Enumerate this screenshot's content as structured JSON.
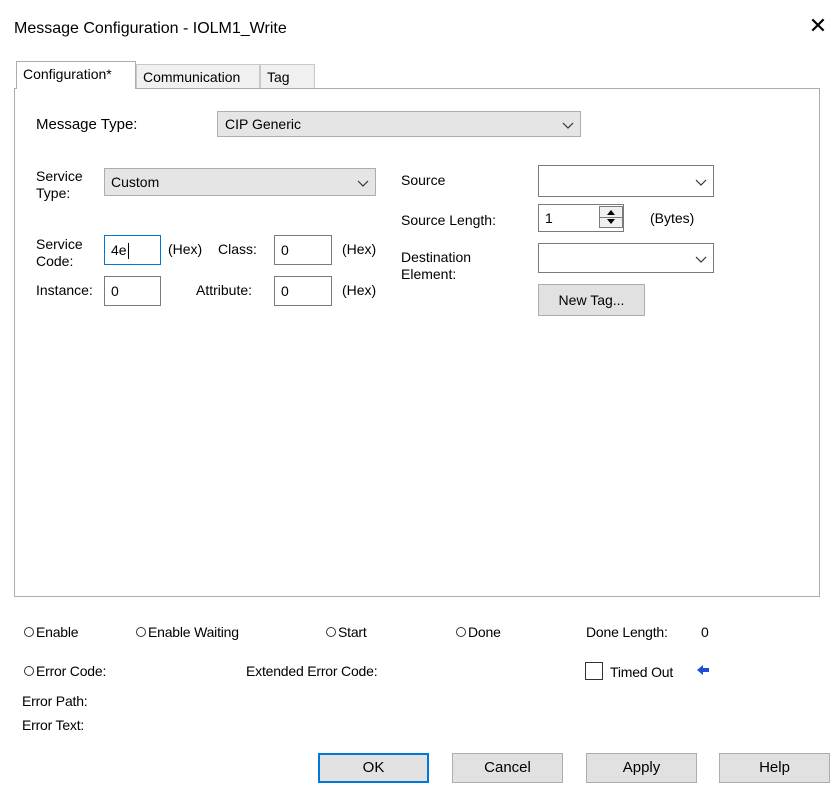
{
  "window": {
    "title": "Message Configuration - IOLM1_Write",
    "close_glyph": "✕"
  },
  "tabs": [
    {
      "label": "Configuration*",
      "active": true
    },
    {
      "label": "Communication",
      "active": false
    },
    {
      "label": "Tag",
      "active": false
    }
  ],
  "config": {
    "message_type_label": "Message Type:",
    "message_type_value": "CIP Generic",
    "service_type_label_1": "Service",
    "service_type_label_2": "Type:",
    "service_type_value": "Custom",
    "service_code_label_1": "Service",
    "service_code_label_2": "Code:",
    "service_code_value": "4e",
    "hex_label": "(Hex)",
    "class_label": "Class:",
    "class_value": "0",
    "instance_label": "Instance:",
    "instance_value": "0",
    "attribute_label": "Attribute:",
    "attribute_value": "0",
    "source_label": "Source",
    "source_value": "",
    "source_length_label": "Source Length:",
    "source_length_value": "1",
    "bytes_label": "(Bytes)",
    "destination_label_1": "Destination",
    "destination_label_2": "Element:",
    "destination_value": "",
    "new_tag_button": "New Tag..."
  },
  "status": {
    "enable": "Enable",
    "enable_waiting": "Enable Waiting",
    "start": "Start",
    "done": "Done",
    "done_length_label": "Done Length:",
    "done_length_value": "0",
    "error_code": "Error Code:",
    "extended_error_code": "Extended Error Code:",
    "timed_out": "Timed Out",
    "error_path": "Error Path:",
    "error_text": "Error Text:"
  },
  "buttons": {
    "ok": "OK",
    "cancel": "Cancel",
    "apply": "Apply",
    "help": "Help"
  },
  "colors": {
    "accent": "#0078d7",
    "arrow": "#1a4fd6"
  }
}
